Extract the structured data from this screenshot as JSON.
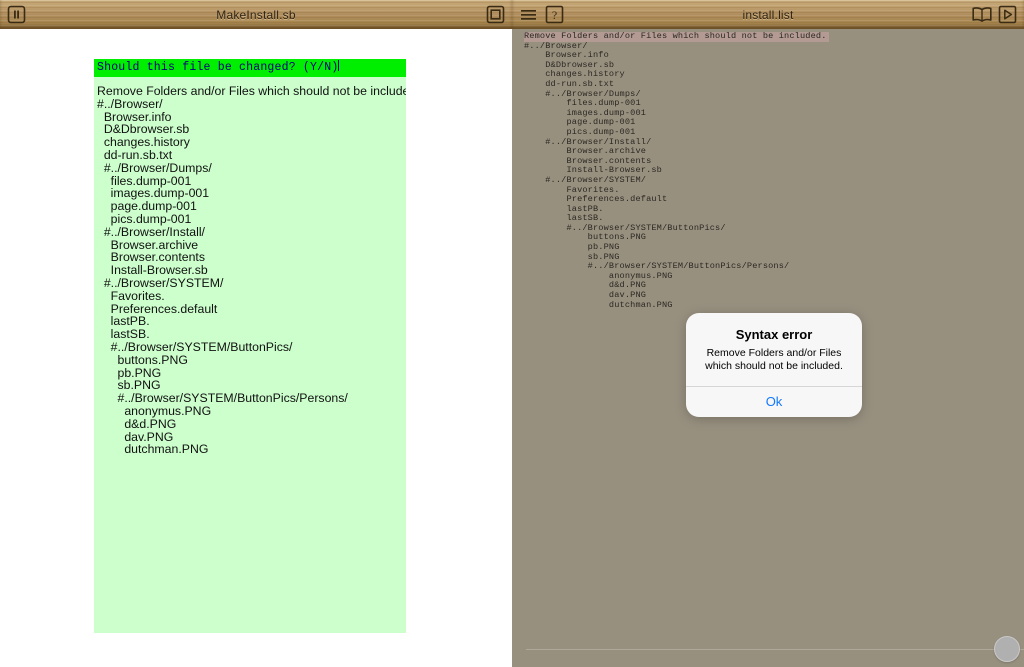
{
  "left_window": {
    "title": "MakeInstall.sb",
    "toolbar": {
      "pause_label": "pause-button",
      "window_label": "window-button"
    },
    "prompt": "Should this file be changed? (Y/N)",
    "lines": [
      "Remove Folders and/or Files which should not be included.",
      "#../Browser/",
      "  Browser.info",
      "  D&Dbrowser.sb",
      "  changes.history",
      "  dd-run.sb.txt",
      "  #../Browser/Dumps/",
      "    files.dump-001",
      "    images.dump-001",
      "    page.dump-001",
      "    pics.dump-001",
      "  #../Browser/Install/",
      "    Browser.archive",
      "    Browser.contents",
      "    Install-Browser.sb",
      "  #../Browser/SYSTEM/",
      "    Favorites.",
      "    Preferences.default",
      "    lastPB.",
      "    lastSB.",
      "    #../Browser/SYSTEM/ButtonPics/",
      "      buttons.PNG",
      "      pb.PNG",
      "      sb.PNG",
      "      #../Browser/SYSTEM/ButtonPics/Persons/",
      "        anonymus.PNG",
      "        d&d.PNG",
      "        dav.PNG",
      "        dutchman.PNG"
    ]
  },
  "right_window": {
    "title": "install.list",
    "toolbar": {
      "menu_label": "menu-button",
      "help_label": "help-button",
      "book_label": "book-button",
      "run_label": "run-button"
    },
    "lines": [
      "Remove Folders and/or Files which should not be included.",
      "#../Browser/",
      "    Browser.info",
      "    D&Dbrowser.sb",
      "    changes.history",
      "    dd-run.sb.txt",
      "    #../Browser/Dumps/",
      "        files.dump-001",
      "        images.dump-001",
      "        page.dump-001",
      "        pics.dump-001",
      "    #../Browser/Install/",
      "        Browser.archive",
      "        Browser.contents",
      "        Install-Browser.sb",
      "    #../Browser/SYSTEM/",
      "        Favorites.",
      "        Preferences.default",
      "        lastPB.",
      "        lastSB.",
      "        #../Browser/SYSTEM/ButtonPics/",
      "            buttons.PNG",
      "            pb.PNG",
      "            sb.PNG",
      "            #../Browser/SYSTEM/ButtonPics/Persons/",
      "                anonymus.PNG",
      "                d&d.PNG",
      "                dav.PNG",
      "                dutchman.PNG"
    ],
    "highlight_line_index": 0
  },
  "alert": {
    "title": "Syntax error",
    "message": "Remove Folders and/or Files which should not be included.",
    "ok_label": "Ok"
  },
  "colors": {
    "prompt_bg": "#00ee00",
    "prompt_fg": "#000080",
    "doc_bg": "#ccffcc",
    "right_bg": "#98907f",
    "right_highlight": "#b39a93",
    "alert_accent": "#1177ff",
    "wood": "#b08d5c"
  }
}
